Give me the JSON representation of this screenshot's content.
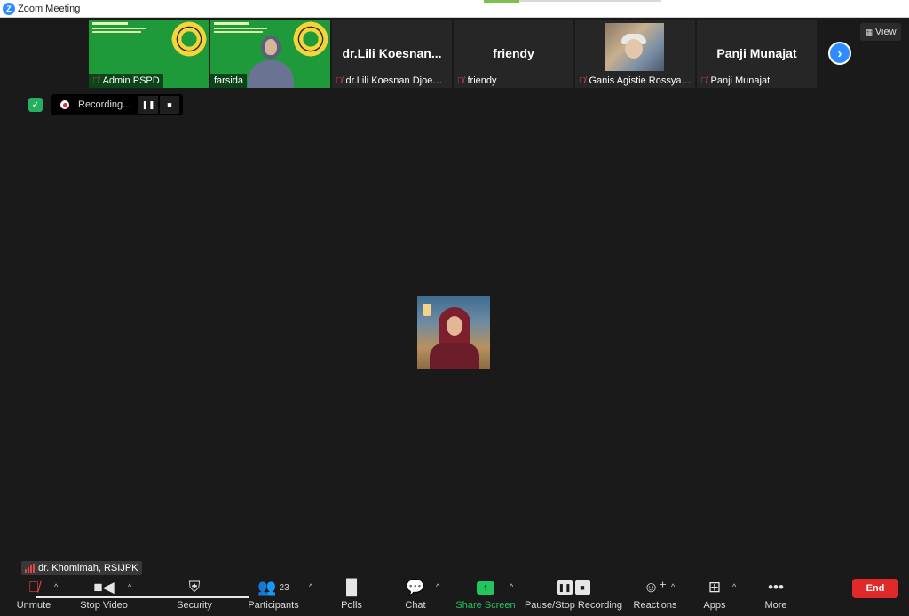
{
  "window": {
    "title": "Zoom Meeting"
  },
  "view_label": "View",
  "thumbnails": [
    {
      "name": "Admin PSPD",
      "kind": "green-slide"
    },
    {
      "name": "farsida",
      "kind": "green-slide-person"
    },
    {
      "name": "dr.Lili Koesnan Djoewa...",
      "display_name": "dr.Lili  Koesnan...",
      "kind": "name"
    },
    {
      "name": "friendy",
      "display_name": "friendy",
      "kind": "name"
    },
    {
      "name": "Ganis Agistie Rossyani...",
      "kind": "photo"
    },
    {
      "name": "Panji Munajat",
      "display_name": "Panji Munajat",
      "kind": "name"
    }
  ],
  "recording": {
    "label": "Recording..."
  },
  "active_speaker": {
    "name": "dr. Khomimah, RSIJPK"
  },
  "toolbar": {
    "unmute": "Unmute",
    "stop_video": "Stop Video",
    "security": "Security",
    "participants": "Participants",
    "participants_count": "23",
    "polls": "Polls",
    "chat": "Chat",
    "share_screen": "Share Screen",
    "pause_stop_recording": "Pause/Stop Recording",
    "reactions": "Reactions",
    "apps": "Apps",
    "more": "More",
    "end": "End"
  },
  "colors": {
    "background": "#1a1a1a",
    "accent_blue": "#2d8cff",
    "share_green": "#22c55e",
    "end_red": "#e02a2a",
    "slide_green": "#1e9a3a"
  },
  "icons": {
    "logo": "zoom-logo-icon",
    "mic_off": "mic-off-icon",
    "next": "chevron-right-icon",
    "view": "grid-icon",
    "shield": "shield-check-icon"
  }
}
